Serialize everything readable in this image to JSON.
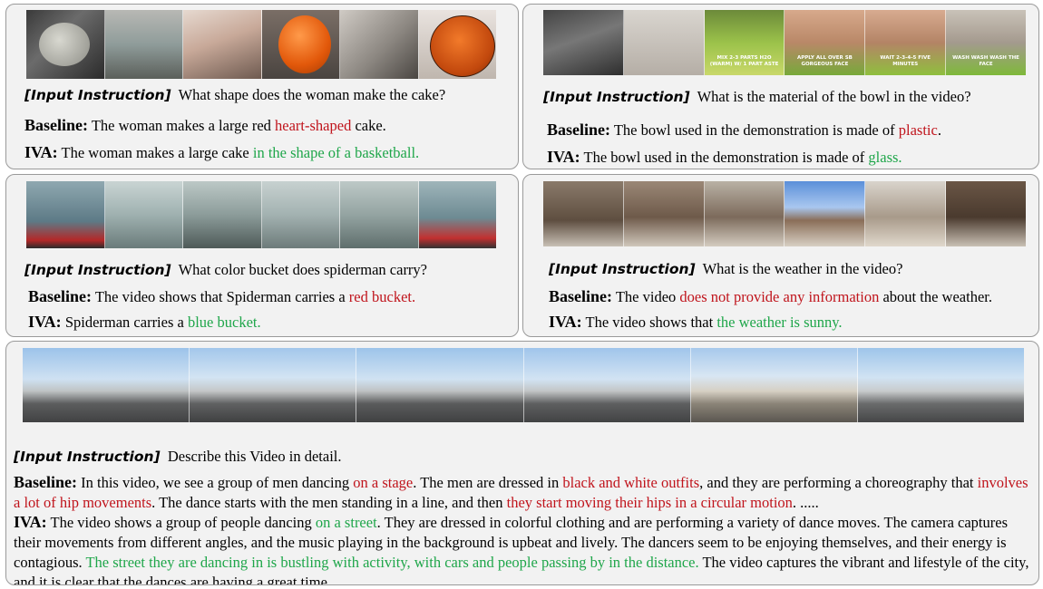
{
  "panels": {
    "cake": {
      "instruction_label": "[Input Instruction]",
      "instruction": "What shape does the woman make the cake?",
      "baseline_label": "Baseline:",
      "baseline_pre": "The woman makes a large red ",
      "baseline_red": "heart-shaped",
      "baseline_post": " cake.",
      "iva_label": "IVA:",
      "iva_pre": "The woman makes a large cake ",
      "iva_green": "in the shape of a basketball."
    },
    "bowl": {
      "instruction_label": "[Input Instruction]",
      "instruction": "What  is the material of the bowl in the video?",
      "baseline_label": "Baseline:",
      "baseline_pre": "The bowl used in the demonstration is made of ",
      "baseline_red": "plastic",
      "baseline_post": ".",
      "iva_label": "IVA:",
      "iva_pre": "The bowl used in the demonstration is made of ",
      "iva_green": "glass.",
      "frame_captions": [
        "MIX 2-3 PARTS H2O (WARM) W/ 1 PART ASTE",
        "APPLY ALL OVER SB GORGEOUS FACE",
        "WAIT 2-3-4-5 FIVE MINUTES",
        "WASH WASH WASH THE FACE"
      ]
    },
    "spiderman": {
      "instruction_label": "[Input Instruction]",
      "instruction": "What color bucket does spiderman carry?",
      "baseline_label": "Baseline:",
      "baseline_pre": "The video shows that Spiderman carries a ",
      "baseline_red": "red bucket.",
      "iva_label": "IVA:",
      "iva_pre": "Spiderman carries a ",
      "iva_green": "blue bucket."
    },
    "weather": {
      "instruction_label": "[Input Instruction]",
      "instruction": "What is the weather in the video?",
      "baseline_label": "Baseline:",
      "baseline_pre": "The video ",
      "baseline_red": "does not provide any information",
      "baseline_post": " about the weather.",
      "iva_label": "IVA:",
      "iva_pre": "The video shows that ",
      "iva_green": "the weather is sunny."
    },
    "dance": {
      "instruction_label": "[Input Instruction]",
      "instruction": "Describe this Video in detail.",
      "baseline_label": "Baseline:",
      "baseline_t1": "In this video, we see a group of men dancing ",
      "baseline_r1": "on a stage",
      "baseline_t2": ". The men are dressed in ",
      "baseline_r2": "black and white outfits",
      "baseline_t3": ", and they are performing a choreography that ",
      "baseline_r3": "involves a lot of hip movements",
      "baseline_t4": ". The dance starts with the men standing in a line, and then ",
      "baseline_r4": "they start moving their hips in a circular motion",
      "baseline_t5": ". .....",
      "iva_label": "IVA:",
      "iva_t1": "The video shows a group of people dancing ",
      "iva_g1": "on a street",
      "iva_t2": ". They are dressed in colorful clothing and are performing a variety of dance moves. The camera captures their movements from different angles, and the music playing in the background is upbeat and lively. The dancers seem to be enjoying themselves, and their energy is contagious. ",
      "iva_g2": "The street they are dancing in is bustling with activity, with cars and people passing by in the distance.",
      "iva_t3": " The video captures the vibrant and lifestyle of the city, and it is clear that the dances are having a great time. ......"
    }
  }
}
